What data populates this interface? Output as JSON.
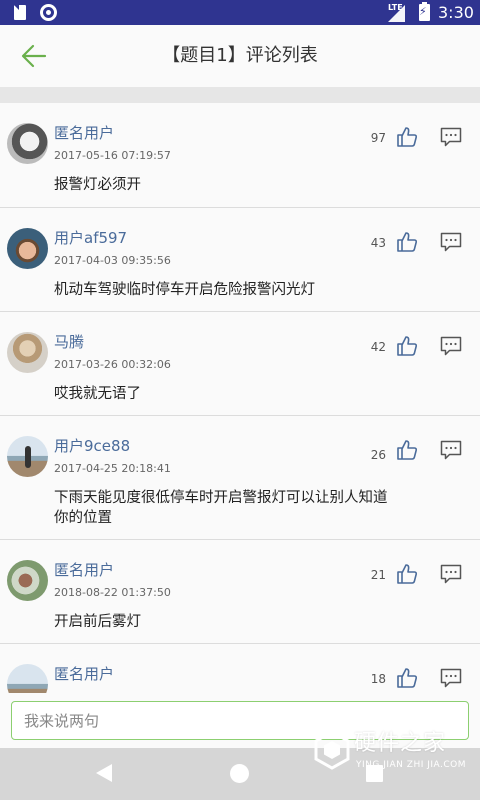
{
  "status_bar": {
    "network": "LTE",
    "time": "3:30",
    "icons": [
      "sd-card-icon",
      "sync-icon",
      "signal-icon",
      "battery-charging-icon"
    ]
  },
  "app_bar": {
    "title": "【题目1】评论列表",
    "back_icon": "back-arrow-icon",
    "accent_color": "#6ab04c"
  },
  "comments": [
    {
      "user": "匿名用户",
      "time": "2017-05-16 07:19:57",
      "text": "报警灯必须开",
      "likes": "97"
    },
    {
      "user": "用户af597",
      "time": "2017-04-03 09:35:56",
      "text": "机动车驾驶临时停车开启危险报警闪光灯",
      "likes": "43"
    },
    {
      "user": "马腾",
      "time": "2017-03-26 00:32:06",
      "text": "哎我就无语了",
      "likes": "42"
    },
    {
      "user": "用户9ce88",
      "time": "2017-04-25 20:18:41",
      "text": "下雨天能见度很低停车时开启警报灯可以让别人知道你的位置",
      "likes": "26"
    },
    {
      "user": "匿名用户",
      "time": "2018-08-22 01:37:50",
      "text": "开启前后雾灯",
      "likes": "21"
    },
    {
      "user": "匿名用户",
      "time": "",
      "text": "",
      "likes": "18"
    }
  ],
  "input": {
    "placeholder": "我来说两句",
    "value": ""
  },
  "watermark": {
    "title": "硬件之家",
    "subtitle": "YING JIAN ZHI JIA.COM"
  }
}
